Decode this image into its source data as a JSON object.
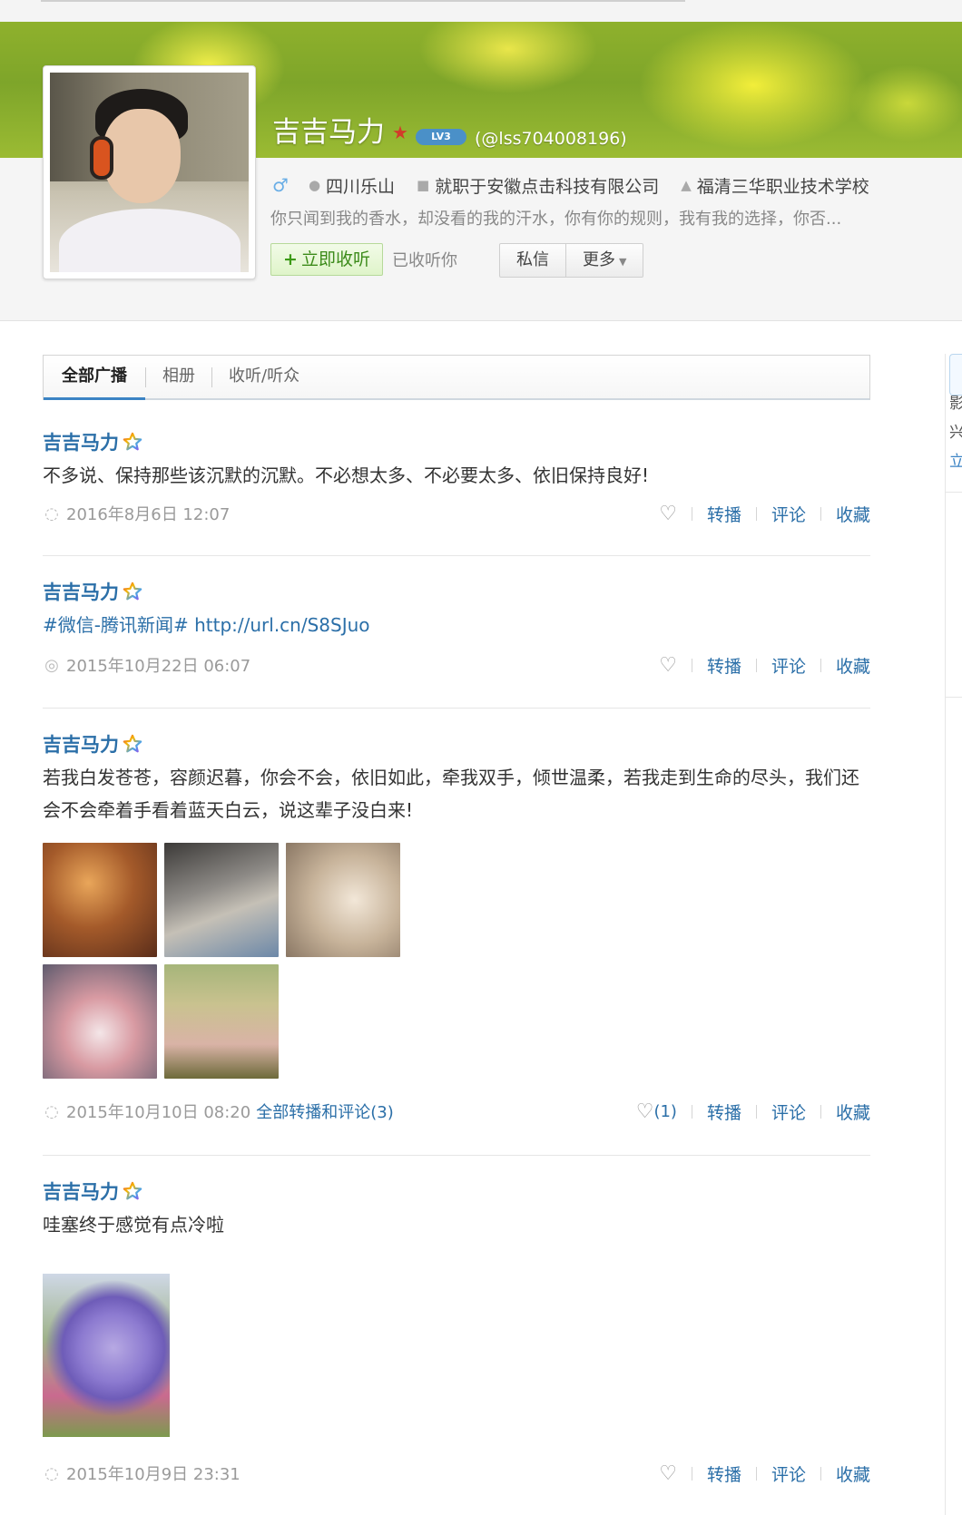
{
  "profile": {
    "name": "吉吉马力",
    "level_badge": "LV3",
    "handle": "(@lss704008196)",
    "gender_symbol": "♂",
    "location": "四川乐山",
    "work": "就职于安徽点击科技有限公司",
    "school": "福清三华职业技术学校",
    "bio": "你只闻到我的香水，却没看的我的汗水，你有你的规则，我有我的选择，你否...",
    "follow_button": "立即收听",
    "follow_plus": "+",
    "followed_status": "已收听你",
    "message_button": "私信",
    "more_button": "更多"
  },
  "tabs": [
    {
      "label": "全部广播",
      "active": true
    },
    {
      "label": "相册",
      "active": false
    },
    {
      "label": "收听/听众",
      "active": false
    }
  ],
  "right_column": {
    "chars": [
      "影",
      "兴",
      "立"
    ]
  },
  "posts": [
    {
      "author": "吉吉马力",
      "text": "不多说、保持那些该沉默的沉默。不必想太多、不必要太多、依旧保持良好!",
      "time": "2016年8月6日 12:07",
      "source_icon": "qq-icon",
      "all_link": "",
      "like_count": "",
      "actions": {
        "repost": "转播",
        "comment": "评论",
        "favorite": "收藏"
      }
    },
    {
      "author": "吉吉马力",
      "text_topic": "#微信-腾讯新闻#",
      "text_link": "http://url.cn/S8SJuo",
      "time": "2015年10月22日 06:07",
      "source_icon": "wechat-icon",
      "all_link": "",
      "like_count": "",
      "actions": {
        "repost": "转播",
        "comment": "评论",
        "favorite": "收藏"
      }
    },
    {
      "author": "吉吉马力",
      "text": "若我白发苍苍，容颜迟暮，你会不会，依旧如此，牵我双手，倾世温柔，若我走到生命的尽头，我们还会不会牵着手看着蓝天白云，说这辈子没白来!",
      "time": "2015年10月10日 08:20",
      "source_icon": "qq-icon",
      "all_link": "全部转播和评论(3)",
      "like_count": "(1)",
      "actions": {
        "repost": "转播",
        "comment": "评论",
        "favorite": "收藏"
      }
    },
    {
      "author": "吉吉马力",
      "text": "哇塞终于感觉有点冷啦",
      "time": "2015年10月9日 23:31",
      "source_icon": "qq-icon",
      "all_link": "",
      "like_count": "",
      "actions": {
        "repost": "转播",
        "comment": "评论",
        "favorite": "收藏"
      }
    }
  ],
  "colors": {
    "link_blue": "#2b6fa8",
    "follow_green": "#3c8b1a",
    "tab_accent": "#3b83c4"
  }
}
